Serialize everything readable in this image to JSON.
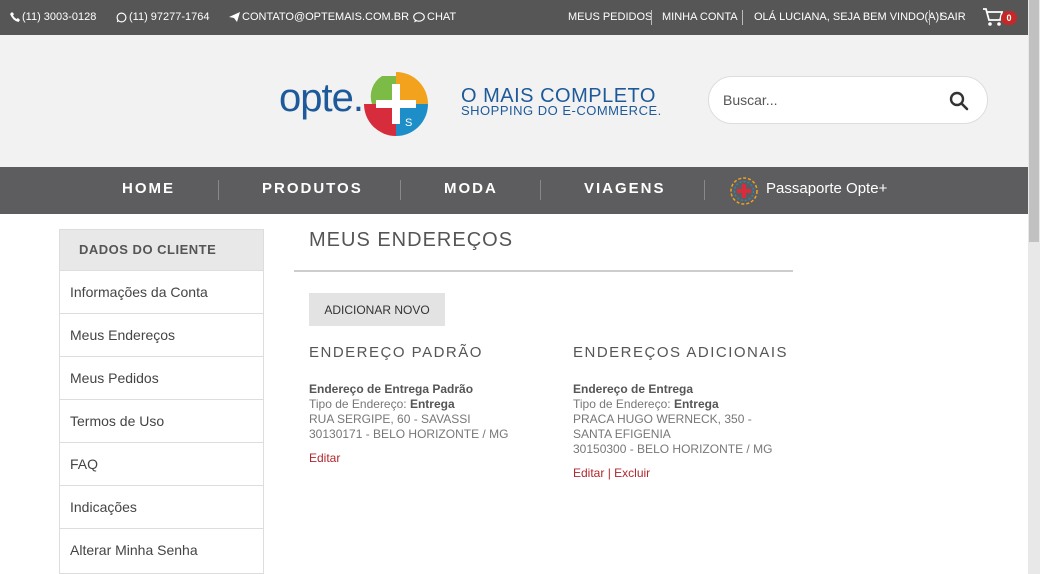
{
  "topbar": {
    "phone1": "(11) 3003-0128",
    "phone2": "(11) 97277-1764",
    "email": "CONTATO@OPTEMAIS.COM.BR",
    "chat": "CHAT",
    "meus_pedidos": "MEUS PEDIDOS",
    "minha_conta": "MINHA CONTA",
    "greeting": "OLÁ LUCIANA, SEJA BEM VINDO(A)!",
    "sair": "SAIR",
    "cart_count": "0"
  },
  "header": {
    "logo_text": "opte.",
    "logo_s": "S",
    "tagline_line1": "O MAIS COMPLETO",
    "tagline_line2": "SHOPPING DO E-COMMERCE.",
    "search_placeholder": "Buscar..."
  },
  "nav": {
    "items": [
      "HOME",
      "PRODUTOS",
      "MODA",
      "VIAGENS"
    ],
    "passaporte": "Passaporte Opte+"
  },
  "sidebar": {
    "title": "DADOS DO CLIENTE",
    "items": [
      "Informações da Conta",
      "Meus Endereços",
      "Meus Pedidos",
      "Termos de Uso",
      "FAQ",
      "Indicações",
      "Alterar Minha Senha"
    ]
  },
  "main": {
    "title": "MEUS ENDEREÇOS",
    "add_button": "ADICIONAR NOVO",
    "default_section": {
      "title": "ENDEREÇO PADRÃO",
      "heading": "Endereço de Entrega Padrão",
      "type_label": "Tipo de Endereço:",
      "type_value": "Entrega",
      "line1": "RUA SERGIPE, 60 - SAVASSI",
      "line2": "30130171 - BELO HORIZONTE / MG",
      "edit": "Editar"
    },
    "additional_section": {
      "title": "ENDEREÇOS ADICIONAIS",
      "heading": "Endereço de Entrega",
      "type_label": "Tipo de Endereço:",
      "type_value": "Entrega",
      "line1": "PRACA HUGO WERNECK, 350 -",
      "line2": "SANTA EFIGENIA",
      "line3": "30150300 - BELO HORIZONTE / MG",
      "edit": "Editar",
      "separator": "|",
      "delete": "Excluir"
    }
  },
  "colors": {
    "topbar": "#565656",
    "nav": "#5d5d5f",
    "brand_blue": "#1e5a9a",
    "link_red": "#b0272d"
  }
}
